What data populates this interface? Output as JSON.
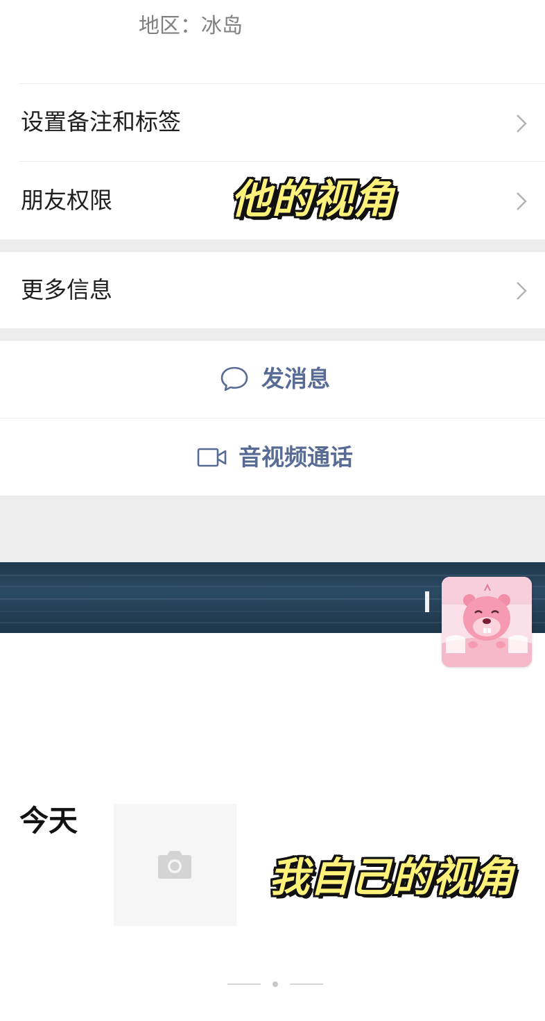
{
  "profile": {
    "region_text": "地区：冰岛"
  },
  "menu": {
    "remark_tags": "设置备注和标签",
    "friend_permissions": "朋友权限",
    "more_info": "更多信息"
  },
  "actions": {
    "send_message": "发消息",
    "av_call": "音视频通话"
  },
  "moments": {
    "today_label": "今天"
  },
  "overlay_captions": {
    "his_view": "他的视角",
    "my_view": "我自己的视角"
  },
  "colors": {
    "link_blue": "#576b95",
    "caption_yellow": "#fff27a",
    "section_gap": "#ededed"
  },
  "icons": {
    "chevron": "chevron-right-icon",
    "message": "chat-bubble-icon",
    "video": "video-camera-icon",
    "camera": "camera-icon"
  }
}
